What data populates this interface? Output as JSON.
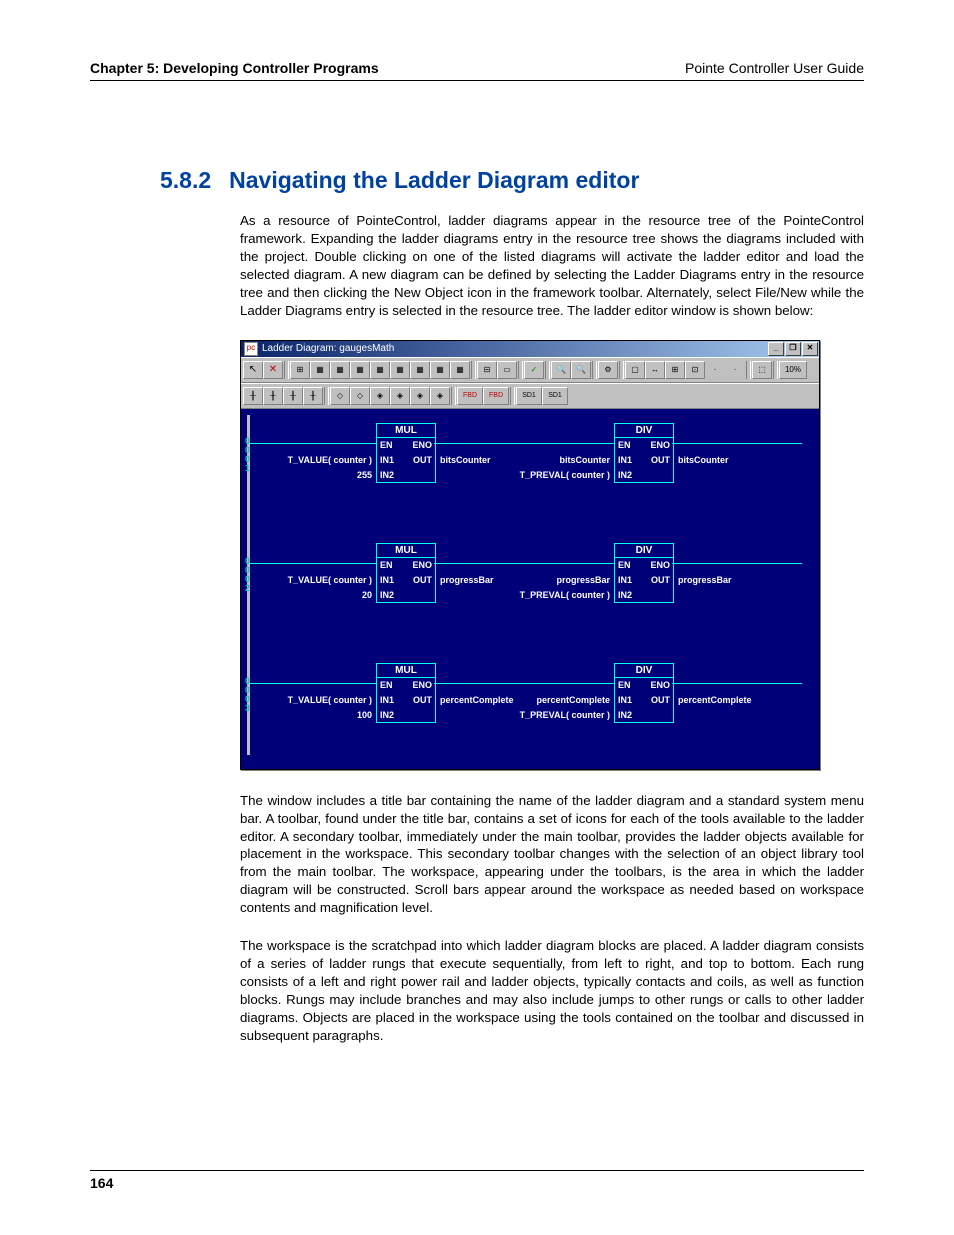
{
  "header": {
    "left": "Chapter 5: Developing Controller Programs",
    "right": "Pointe Controller User Guide"
  },
  "section": {
    "number": "5.8.2",
    "title": "Navigating the Ladder Diagram editor"
  },
  "paragraphs": {
    "p1": "As a resource of PointeControl, ladder diagrams appear in the resource tree of the PointeControl framework. Expanding the ladder diagrams entry in the resource tree shows the diagrams included with the project. Double clicking on one of the listed diagrams will activate the ladder editor and load the selected diagram. A new diagram can be defined by selecting the Ladder Diagrams entry in the resource tree and then clicking the New Object icon in the framework toolbar. Alternately, select File/New while the Ladder Diagrams entry is selected in the resource tree. The ladder editor window is shown below:",
    "p2": "The window includes a title bar containing the name of the ladder diagram and a standard system menu bar. A toolbar, found under the title bar, contains a set of icons for each of the tools available to the ladder editor. A secondary toolbar, immediately under the main toolbar, provides the ladder objects available for placement in the workspace. This secondary toolbar changes with the selection of an object library tool from the main toolbar. The workspace, appearing under the toolbars, is the area in which the ladder diagram will be constructed. Scroll bars appear around the workspace as needed based on workspace contents and magnification level.",
    "p3": "The workspace is the scratchpad into which ladder diagram blocks are placed. A ladder diagram consists of a series of ladder rungs that execute sequentially, from left to right, and top to bottom. Each rung consists of a left and right power rail and ladder objects, typically contacts and coils, as well as function blocks. Rungs may include branches and may also include jumps to other rungs or calls to other ladder diagrams. Objects are placed in the workspace using the tools contained on the toolbar and discussed in subsequent paragraphs."
  },
  "window": {
    "title": "Ladder Diagram: gaugesMath",
    "buttons": {
      "min": "_",
      "max": "❐",
      "close": "✕"
    },
    "toolbar1": {
      "arrow": "↖",
      "delete": "✕",
      "grp1": [
        "⊞",
        "▦",
        "▦",
        "▦",
        "▦",
        "▦",
        "▦",
        "▦",
        "▦"
      ],
      "grp2": [
        "⊟",
        "▭"
      ],
      "check": "✓",
      "zoom": [
        "🔍",
        "🔍"
      ],
      "cfg": "⚙",
      "grp3": [
        "▢",
        "↔",
        "⊞",
        "⊡",
        "·",
        "·"
      ],
      "misc": [
        "⬚",
        "10%"
      ]
    },
    "toolbar2": {
      "g1": [
        "╫",
        "╫",
        "╫",
        "╫"
      ],
      "g2": [
        "◇",
        "◇",
        "◈",
        "◈",
        "◈",
        "◈"
      ],
      "g3": [
        "FBD",
        "FBD"
      ],
      "g4": [
        "SD1",
        "SD1"
      ]
    },
    "pins": {
      "EN": "EN",
      "ENO": "ENO",
      "IN1": "IN1",
      "IN2": "IN2",
      "OUT": "OUT"
    },
    "rungs": [
      {
        "id": "0\n0\n0\n1",
        "left_block": "MUL",
        "left_in1": "T_VALUE( counter )",
        "left_in2": "255",
        "left_out": "bitsCounter",
        "right_block": "DIV",
        "right_in1": "bitsCounter",
        "right_in2": "T_PREVAL( counter )",
        "right_out": "bitsCounter"
      },
      {
        "id": "0\n0\n0\n2",
        "left_block": "MUL",
        "left_in1": "T_VALUE( counter )",
        "left_in2": "20",
        "left_out": "progressBar",
        "right_block": "DIV",
        "right_in1": "progressBar",
        "right_in2": "T_PREVAL( counter )",
        "right_out": "progressBar"
      },
      {
        "id": "0\n0\n0\n3",
        "left_block": "MUL",
        "left_in1": "T_VALUE( counter )",
        "left_in2": "100",
        "left_out": "percentComplete",
        "right_block": "DIV",
        "right_in1": "percentComplete",
        "right_in2": "T_PREVAL( counter )",
        "right_out": "percentComplete"
      }
    ]
  },
  "page_number": "164"
}
